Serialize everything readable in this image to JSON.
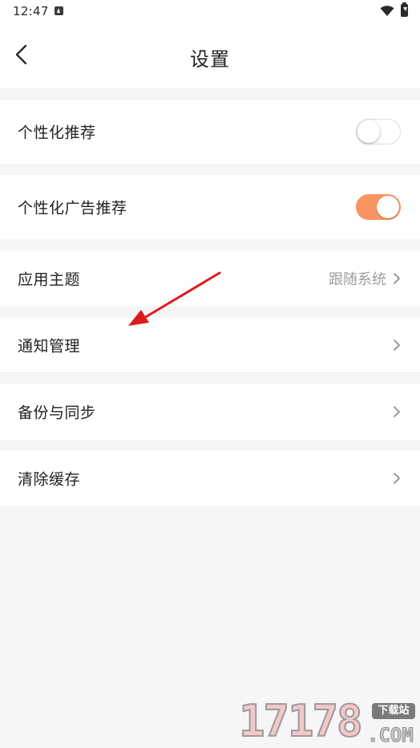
{
  "status_bar": {
    "time": "12:47",
    "icons": [
      "a-notification-icon",
      "wifi-icon",
      "battery-charging-icon"
    ]
  },
  "header": {
    "title": "设置",
    "back_icon": "chevron-left-icon"
  },
  "settings": {
    "personalized_recommendation": {
      "label": "个性化推荐",
      "enabled": false
    },
    "personalized_ads": {
      "label": "个性化广告推荐",
      "enabled": true
    },
    "app_theme": {
      "label": "应用主题",
      "value": "跟随系统"
    },
    "notification_management": {
      "label": "通知管理"
    },
    "backup_sync": {
      "label": "备份与同步"
    },
    "clear_cache": {
      "label": "清除缓存"
    }
  },
  "colors": {
    "accent": "#fa9461",
    "annotation_arrow": "#e0191f",
    "background": "#f6f6f6"
  },
  "annotation": {
    "type": "arrow",
    "points_to": "notification_management"
  },
  "watermark": {
    "number": "17178",
    "badge": "下载站",
    "domain": ".COM"
  }
}
